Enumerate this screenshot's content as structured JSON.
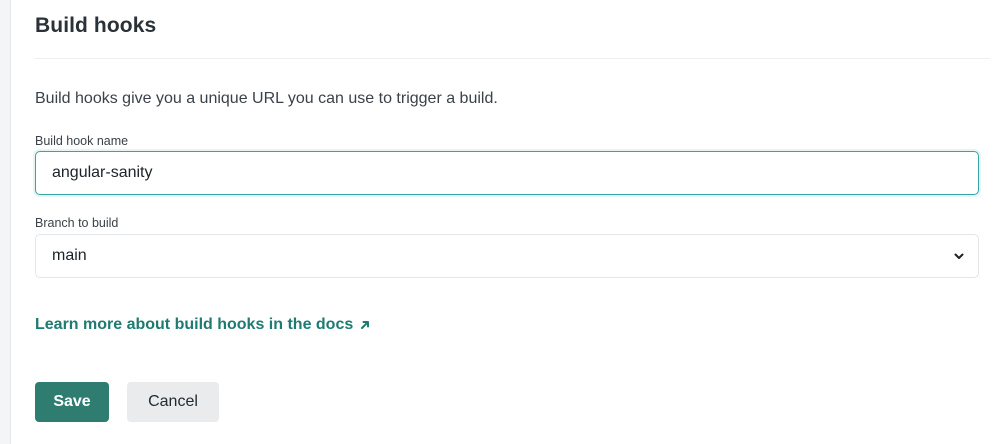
{
  "section": {
    "title": "Build hooks",
    "description": "Build hooks give you a unique URL you can use to trigger a build."
  },
  "form": {
    "name_label": "Build hook name",
    "name_value": "angular-sanity",
    "branch_label": "Branch to build",
    "branch_selected": "main"
  },
  "docs_link": {
    "text": "Learn more about build hooks in the docs",
    "icon": "external-arrow-icon"
  },
  "actions": {
    "save_label": "Save",
    "cancel_label": "Cancel"
  },
  "colors": {
    "accent": "#2f7d71",
    "link": "#1f7a72",
    "focus_border": "#38a3a5"
  }
}
